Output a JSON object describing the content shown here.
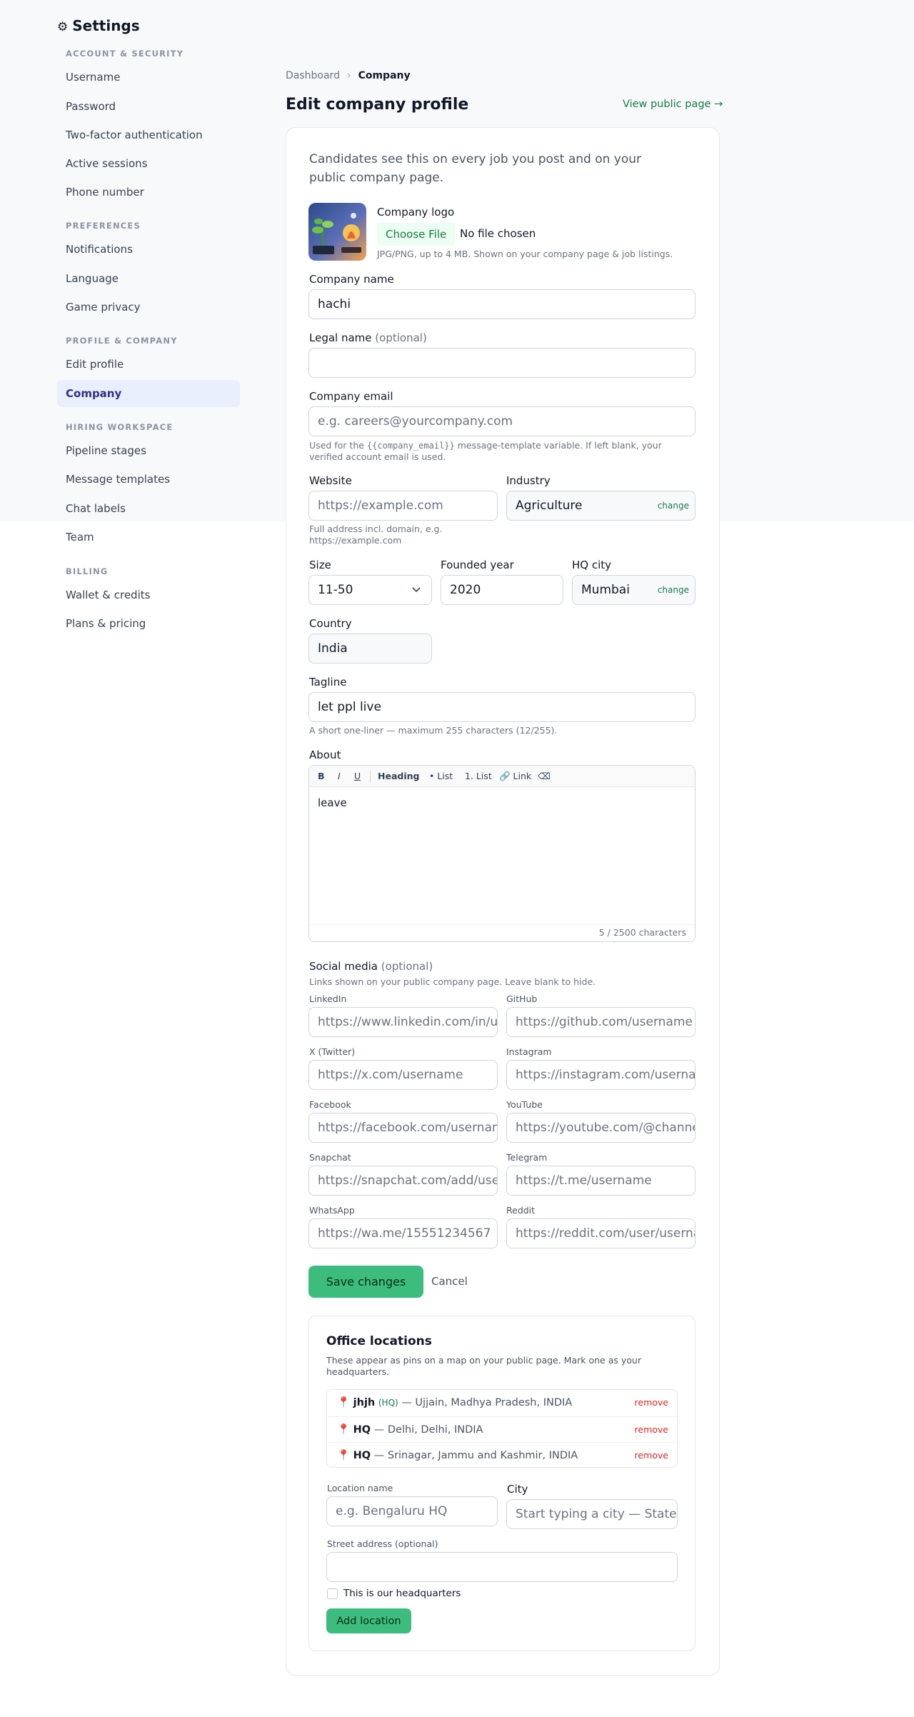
{
  "sidebar": {
    "title": "Settings",
    "sections": {
      "account": {
        "heading": "ACCOUNT & SECURITY",
        "items": [
          "Username",
          "Password",
          "Two-factor authentication",
          "Active sessions",
          "Phone number"
        ]
      },
      "preferences": {
        "heading": "PREFERENCES",
        "items": [
          "Notifications",
          "Language",
          "Game privacy"
        ]
      },
      "profile": {
        "heading": "PROFILE & COMPANY",
        "items": [
          "Edit profile",
          "Company"
        ]
      },
      "hiring": {
        "heading": "HIRING WORKSPACE",
        "items": [
          "Pipeline stages",
          "Message templates",
          "Chat labels",
          "Team"
        ]
      },
      "billing": {
        "heading": "BILLING",
        "items": [
          "Wallet & credits",
          "Plans & pricing"
        ]
      }
    },
    "active_item": "Company"
  },
  "breadcrumb": {
    "home": "Dashboard",
    "current": "Company"
  },
  "page": {
    "title": "Edit company profile",
    "view_public": "View public page →"
  },
  "form": {
    "intro": "Candidates see this on every job you post and on your public company page.",
    "logo": {
      "label": "Company logo",
      "choose_file": "Choose File",
      "no_file": "No file chosen",
      "hint": "JPG/PNG, up to 4 MB. Shown on your company page & job listings."
    },
    "company_name": {
      "label": "Company name",
      "value": "hachi"
    },
    "legal_name": {
      "label": "Legal name",
      "optional": "(optional)",
      "value": ""
    },
    "company_email": {
      "label": "Company email",
      "placeholder": "e.g. careers@yourcompany.com",
      "hint_pre": "Used for the ",
      "hint_code": "{{company_email}}",
      "hint_post": " message-template variable. If left blank, your verified account email is used."
    },
    "website": {
      "label": "Website",
      "placeholder": "https://example.com",
      "hint": "Full address incl. domain, e.g. https://example.com"
    },
    "industry": {
      "label": "Industry",
      "value": "Agriculture",
      "change": "change"
    },
    "size": {
      "label": "Size",
      "value": "11-50"
    },
    "founded": {
      "label": "Founded year",
      "value": "2020"
    },
    "hq_city": {
      "label": "HQ city",
      "value": "Mumbai",
      "change": "change"
    },
    "country": {
      "label": "Country",
      "value": "India"
    },
    "tagline": {
      "label": "Tagline",
      "value": "let ppl live",
      "hint": "A short one-liner — maximum 255 characters (12/255)."
    },
    "about": {
      "label": "About",
      "toolbar": {
        "bold": "B",
        "italic": "I",
        "underline": "U",
        "heading": "Heading",
        "list": "• List",
        "olist": "1. List",
        "link": "🔗 Link",
        "clear": "⌫"
      },
      "value": "leave",
      "counter": "5 / 2500 characters"
    },
    "social": {
      "label": "Social media",
      "optional": "(optional)",
      "hint": "Links shown on your public company page. Leave blank to hide.",
      "linkedin": {
        "label": "LinkedIn",
        "placeholder": "https://www.linkedin.com/in/username"
      },
      "github": {
        "label": "GitHub",
        "placeholder": "https://github.com/username"
      },
      "x": {
        "label": "X (Twitter)",
        "placeholder": "https://x.com/username"
      },
      "instagram": {
        "label": "Instagram",
        "placeholder": "https://instagram.com/username"
      },
      "facebook": {
        "label": "Facebook",
        "placeholder": "https://facebook.com/username"
      },
      "youtube": {
        "label": "YouTube",
        "placeholder": "https://youtube.com/@channel"
      },
      "snapchat": {
        "label": "Snapchat",
        "placeholder": "https://snapchat.com/add/username"
      },
      "telegram": {
        "label": "Telegram",
        "placeholder": "https://t.me/username"
      },
      "whatsapp": {
        "label": "WhatsApp",
        "placeholder": "https://wa.me/15551234567"
      },
      "reddit": {
        "label": "Reddit",
        "placeholder": "https://reddit.com/user/username"
      }
    },
    "save": "Save changes",
    "cancel": "Cancel"
  },
  "offices": {
    "title": "Office locations",
    "description": "These appear as pins on a map on your public page. Mark one as your headquarters.",
    "locations": [
      {
        "icon": "📍",
        "name": "jhjh",
        "hq_badge": "(HQ)",
        "address": " — Ujjain, Madhya Pradesh, INDIA",
        "remove": "remove"
      },
      {
        "icon": "📍",
        "name": "HQ",
        "hq_badge": "",
        "address": " — Delhi, Delhi, INDIA",
        "remove": "remove"
      },
      {
        "icon": "📍",
        "name": "HQ",
        "hq_badge": "",
        "address": " — Srinagar, Jammu and Kashmir, INDIA",
        "remove": "remove"
      }
    ],
    "location_name": {
      "label": "Location name",
      "placeholder": "e.g. Bengaluru HQ"
    },
    "city": {
      "label": "City",
      "placeholder": "Start typing a city — State"
    },
    "street": {
      "label": "Street address (optional)",
      "placeholder": ""
    },
    "hq_checkbox": "This is our headquarters",
    "add": "Add location"
  },
  "colors": {
    "accent_green": "#3dbd7d",
    "link_green": "#16794a",
    "active_nav_bg": "#eaeffd",
    "danger": "#dc2626"
  }
}
